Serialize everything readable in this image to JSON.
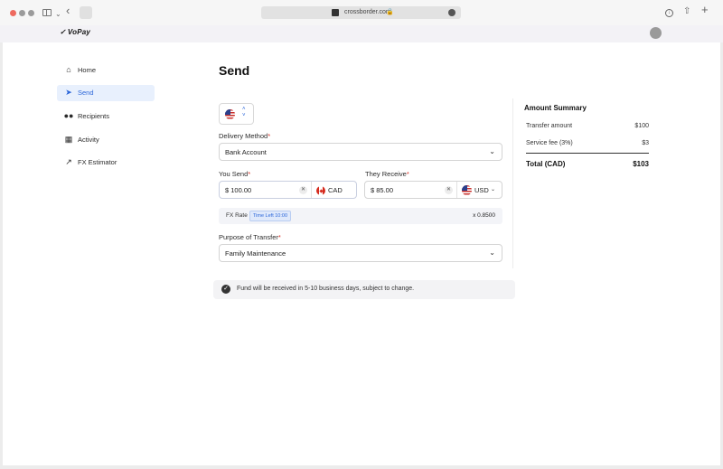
{
  "browser": {
    "url": "crossborder.com"
  },
  "app": {
    "logo": "VoPay"
  },
  "sidebar": {
    "items": [
      {
        "label": "Home",
        "icon": "home-icon"
      },
      {
        "label": "Send",
        "icon": "send-icon",
        "active": true
      },
      {
        "label": "Recipients",
        "icon": "people-icon"
      },
      {
        "label": "Activity",
        "icon": "activity-icon"
      },
      {
        "label": "FX Estimator",
        "icon": "trend-icon"
      }
    ]
  },
  "main": {
    "title": "Send",
    "delivery_method": {
      "label": "Delivery Method",
      "required": "*",
      "value": "Bank Account"
    },
    "you_send": {
      "label": "You Send",
      "required": "*",
      "value": "$ 100.00",
      "currency": "CAD"
    },
    "they_receive": {
      "label": "They Receive",
      "required": "*",
      "value": "$ 85.00",
      "currency": "USD"
    },
    "fx": {
      "label": "FX Rate",
      "timer": "Time Left 10:00",
      "rate": "x 0.8500"
    },
    "purpose": {
      "label": "Purpose of Transfer",
      "required": "*",
      "value": "Family Maintenance"
    },
    "notice": "Fund will be received in 5-10 business days, subject to change."
  },
  "summary": {
    "title": "Amount Summary",
    "rows": [
      {
        "label": "Transfer amount",
        "value": "$100"
      },
      {
        "label": "Service fee (3%)",
        "value": "$3"
      }
    ],
    "total_label": "Total (CAD)",
    "total_value": "$103"
  },
  "colors": {
    "accent": "#2b66d9",
    "active_bg": "#e8f0fd",
    "required": "#d93025"
  }
}
